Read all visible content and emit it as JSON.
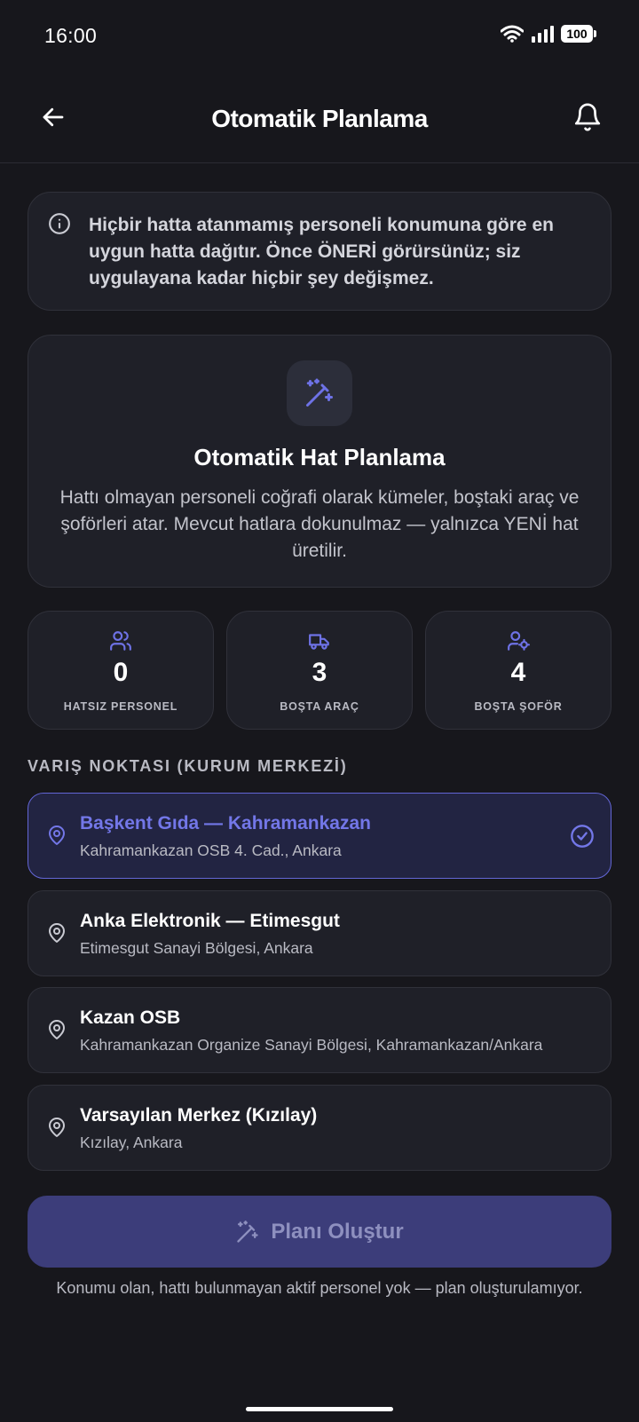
{
  "status_bar": {
    "time": "16:00",
    "battery": "100"
  },
  "header": {
    "title": "Otomatik Planlama"
  },
  "info": {
    "text": "Hiçbir hatta atanmamış personeli konumuna göre en uygun hatta dağıtır. Önce ÖNERİ görürsünüz; siz uygulayana kadar hiçbir şey değişmez."
  },
  "hero": {
    "title": "Otomatik Hat Planlama",
    "description": "Hattı olmayan personeli coğrafi olarak kümeler, boştaki araç ve şoförleri atar. Mevcut hatlara dokunulmaz — yalnızca YENİ hat üretilir."
  },
  "stats": [
    {
      "value": "0",
      "label": "HATSIZ PERSONEL",
      "icon": "users-icon"
    },
    {
      "value": "3",
      "label": "BOŞTA ARAÇ",
      "icon": "truck-icon"
    },
    {
      "value": "4",
      "label": "BOŞTA ŞOFÖR",
      "icon": "user-gear-icon"
    }
  ],
  "destination": {
    "section_label": "VARIŞ NOKTASI (KURUM MERKEZİ)",
    "options": [
      {
        "name": "Başkent Gıda — Kahramankazan",
        "address": "Kahramankazan OSB 4. Cad., Ankara",
        "selected": true
      },
      {
        "name": "Anka Elektronik — Etimesgut",
        "address": "Etimesgut Sanayi Bölgesi, Ankara",
        "selected": false
      },
      {
        "name": "Kazan OSB",
        "address": "Kahramankazan Organize Sanayi Bölgesi, Kahramankazan/Ankara",
        "selected": false
      },
      {
        "name": "Varsayılan Merkez (Kızılay)",
        "address": "Kızılay, Ankara",
        "selected": false
      }
    ]
  },
  "action": {
    "button_label": "Planı Oluştur",
    "disabled": true,
    "hint": "Konumu olan, hattı bulunmayan aktif personel yok — plan oluşturulamıyor."
  },
  "colors": {
    "background": "#17171c",
    "card": "#1f2028",
    "accent": "#6366d6",
    "accent_text": "#7377e8",
    "button_disabled": "#3c3d7a"
  }
}
